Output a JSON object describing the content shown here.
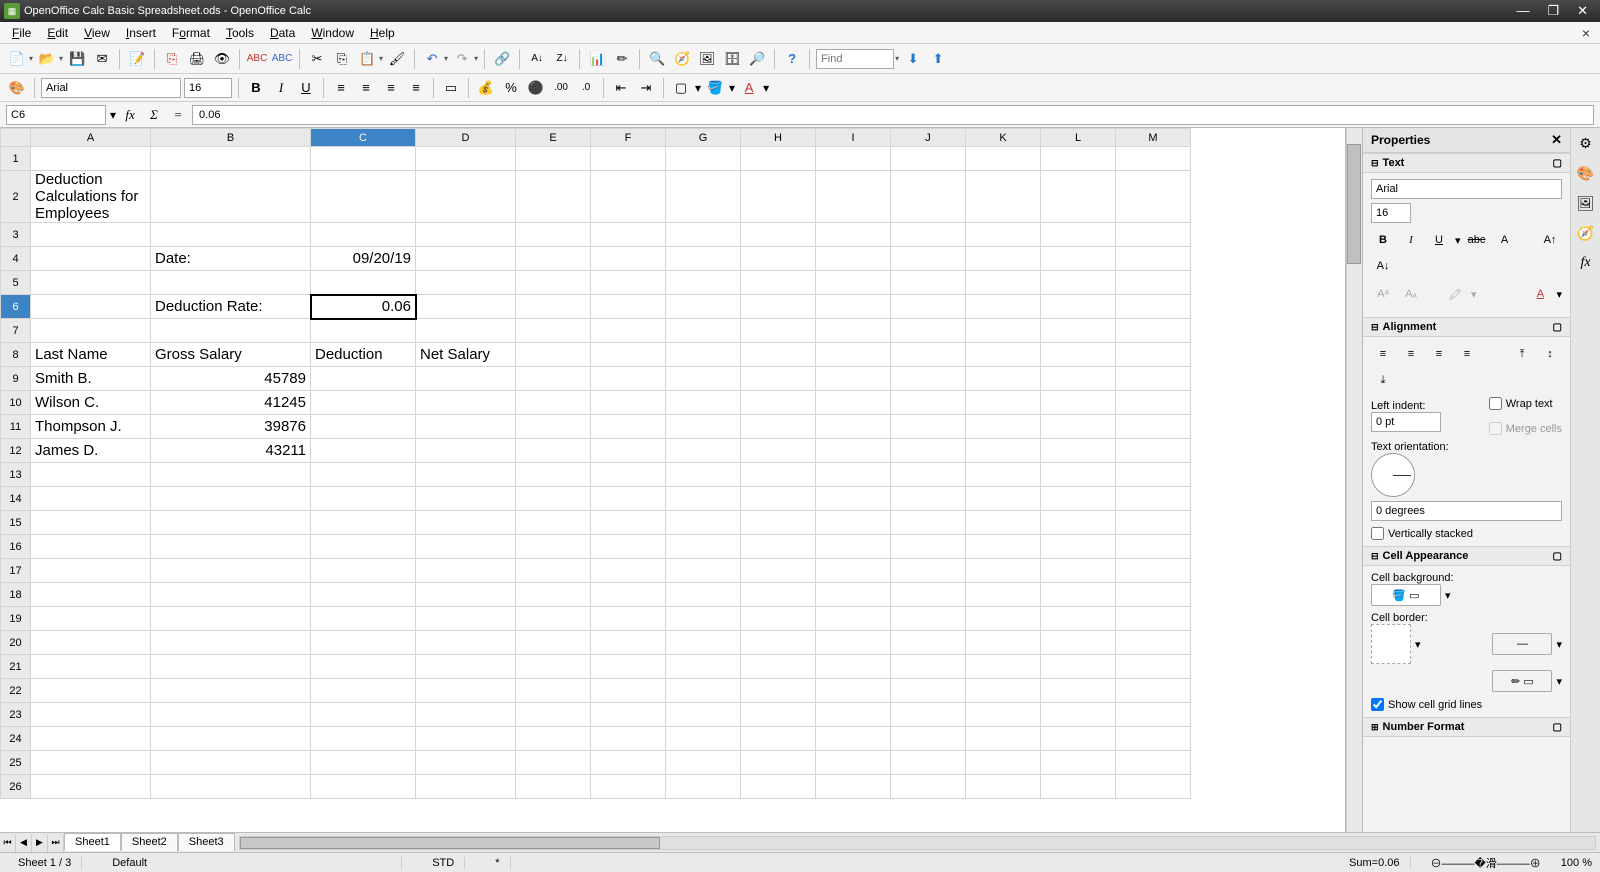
{
  "title": "OpenOffice Calc Basic Spreadsheet.ods - OpenOffice Calc",
  "menu": [
    "File",
    "Edit",
    "View",
    "Insert",
    "Format",
    "Tools",
    "Data",
    "Window",
    "Help"
  ],
  "find_placeholder": "Find",
  "font": {
    "name": "Arial",
    "size": "16"
  },
  "namebox": "C6",
  "formula": "0.06",
  "columns": [
    "A",
    "B",
    "C",
    "D",
    "E",
    "F",
    "G",
    "H",
    "I",
    "J",
    "K",
    "L",
    "M"
  ],
  "rows": 26,
  "selected": {
    "col": "C",
    "row": 6
  },
  "cells": {
    "A2": "Deduction Calculations for Employees",
    "B4": "Date:",
    "C4": "09/20/19",
    "B6": "Deduction Rate:",
    "C6": "0.06",
    "A8": "Last Name",
    "B8": "Gross Salary",
    "C8": "Deduction",
    "D8": "Net Salary",
    "A9": "Smith B.",
    "B9": "45789",
    "A10": "Wilson C.",
    "B10": "41245",
    "A11": "Thompson J.",
    "B11": "39876",
    "A12": "James D.",
    "B12": "43211"
  },
  "right_aligned": [
    "C4",
    "C6",
    "B9",
    "B10",
    "B11",
    "B12"
  ],
  "tabs": [
    "Sheet1",
    "Sheet2",
    "Sheet3"
  ],
  "active_tab": 0,
  "status": {
    "sheet": "Sheet 1 / 3",
    "style": "Default",
    "mode": "STD",
    "modified": "*",
    "sum": "Sum=0.06",
    "zoom": "100 %"
  },
  "sidebar": {
    "title": "Properties",
    "text_section": "Text",
    "alignment_section": "Alignment",
    "left_indent_label": "Left indent:",
    "left_indent_value": "0 pt",
    "wrap_text": "Wrap text",
    "merge_cells": "Merge cells",
    "text_orientation_label": "Text orientation:",
    "orientation_value": "0 degrees",
    "vertically_stacked": "Vertically stacked",
    "cell_appearance_section": "Cell Appearance",
    "cell_background_label": "Cell background:",
    "cell_border_label": "Cell border:",
    "show_grid": "Show cell grid lines",
    "number_format_section": "Number Format"
  }
}
